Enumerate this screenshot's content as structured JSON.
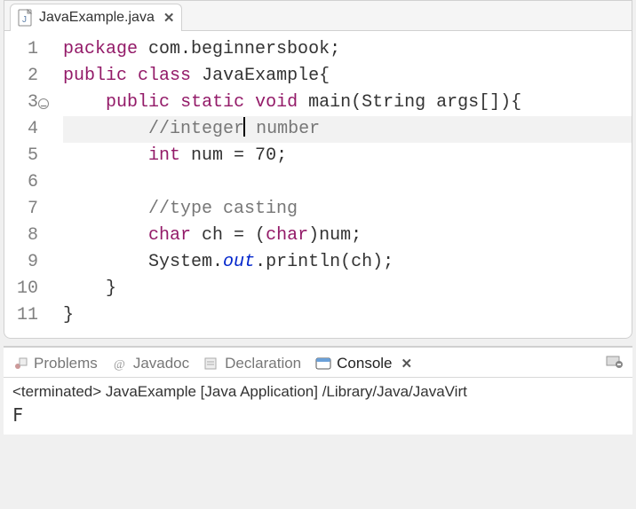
{
  "editor": {
    "tab": {
      "filename": "JavaExample.java"
    },
    "lines": {
      "count": 11,
      "fold_at": 3,
      "highlighted": 4
    },
    "code": {
      "l1_kw1": "package",
      "l1_rest": " com.beginnersbook;",
      "l2_kw1": "public",
      "l2_kw2": "class",
      "l2_name": " JavaExample{",
      "l3_indent": "    ",
      "l3_kw1": "public",
      "l3_kw2": "static",
      "l3_kw3": "void",
      "l3_rest": " main(String args[]){",
      "l4_indent": "        ",
      "l4_cm_a": "//integer",
      "l4_cm_b": " number",
      "l5_indent": "        ",
      "l5_kw": "int",
      "l5_rest": " num = 70;",
      "l6": "",
      "l7_indent": "        ",
      "l7_cm": "//type casting",
      "l8_indent": "        ",
      "l8_kw": "char",
      "l8_a": " ch = (",
      "l8_kw2": "char",
      "l8_b": ")num;",
      "l9_indent": "        ",
      "l9_a": "System.",
      "l9_out": "out",
      "l9_b": ".println(ch);",
      "l10": "    }",
      "l11": "}"
    }
  },
  "bottom": {
    "tabs": {
      "problems": "Problems",
      "javadoc": "Javadoc",
      "declaration": "Declaration",
      "console": "Console"
    },
    "status": "<terminated> JavaExample [Java Application] /Library/Java/JavaVirt",
    "output": "F"
  }
}
